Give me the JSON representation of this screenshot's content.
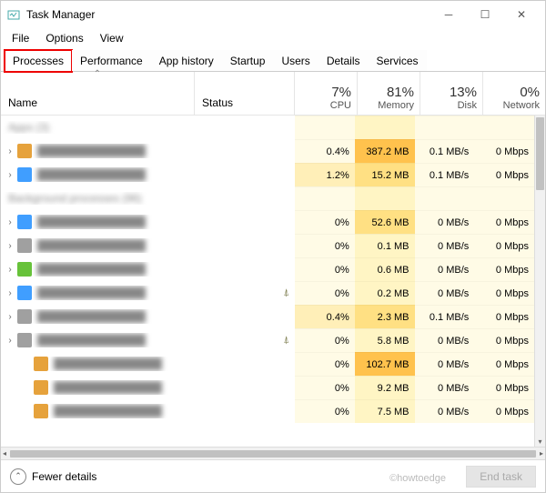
{
  "window": {
    "title": "Task Manager"
  },
  "menu": {
    "file": "File",
    "options": "Options",
    "view": "View"
  },
  "tabs": {
    "processes": "Processes",
    "performance": "Performance",
    "apphistory": "App history",
    "startup": "Startup",
    "users": "Users",
    "details": "Details",
    "services": "Services"
  },
  "columns": {
    "name": "Name",
    "status": "Status",
    "cpu": {
      "pct": "7%",
      "label": "CPU"
    },
    "memory": {
      "pct": "81%",
      "label": "Memory"
    },
    "disk": {
      "pct": "13%",
      "label": "Disk"
    },
    "network": {
      "pct": "0%",
      "label": "Network"
    }
  },
  "rows": [
    {
      "type": "group",
      "name": "Apps (3)"
    },
    {
      "type": "proc",
      "indent": 1,
      "iconColor": "#e6a23c",
      "cpu": "0.4%",
      "mem": "387.2 MB",
      "memHeat": "h",
      "disk": "0.1 MB/s",
      "net": "0 Mbps"
    },
    {
      "type": "proc",
      "indent": 1,
      "iconColor": "#409eff",
      "cpu": "1.2%",
      "cpuHeat": "m",
      "mem": "15.2 MB",
      "memHeat": "m",
      "disk": "0.1 MB/s",
      "net": "0 Mbps"
    },
    {
      "type": "group",
      "name": "Background processes (96)"
    },
    {
      "type": "proc",
      "indent": 1,
      "iconColor": "#409eff",
      "cpu": "0%",
      "mem": "52.6 MB",
      "memHeat": "m",
      "disk": "0 MB/s",
      "net": "0 Mbps"
    },
    {
      "type": "proc",
      "indent": 1,
      "iconColor": "#a0a0a0",
      "cpu": "0%",
      "mem": "0.1 MB",
      "disk": "0 MB/s",
      "net": "0 Mbps"
    },
    {
      "type": "proc",
      "indent": 1,
      "iconColor": "#67c23a",
      "cpu": "0%",
      "mem": "0.6 MB",
      "disk": "0 MB/s",
      "net": "0 Mbps"
    },
    {
      "type": "proc",
      "indent": 1,
      "iconColor": "#409eff",
      "status": "leaf",
      "cpu": "0%",
      "mem": "0.2 MB",
      "disk": "0 MB/s",
      "net": "0 Mbps"
    },
    {
      "type": "proc",
      "indent": 1,
      "iconColor": "#a0a0a0",
      "cpu": "0.4%",
      "cpuHeat": "m",
      "mem": "2.3 MB",
      "memHeat": "m",
      "disk": "0.1 MB/s",
      "net": "0 Mbps"
    },
    {
      "type": "proc",
      "indent": 1,
      "iconColor": "#a0a0a0",
      "status": "leaf",
      "cpu": "0%",
      "mem": "5.8 MB",
      "disk": "0 MB/s",
      "net": "0 Mbps"
    },
    {
      "type": "proc",
      "indent": 2,
      "iconColor": "#e6a23c",
      "cpu": "0%",
      "mem": "102.7 MB",
      "memHeat": "h",
      "disk": "0 MB/s",
      "net": "0 Mbps"
    },
    {
      "type": "proc",
      "indent": 2,
      "iconColor": "#e6a23c",
      "cpu": "0%",
      "mem": "9.2 MB",
      "disk": "0 MB/s",
      "net": "0 Mbps"
    },
    {
      "type": "proc",
      "indent": 2,
      "iconColor": "#e6a23c",
      "cpu": "0%",
      "mem": "7.5 MB",
      "disk": "0 MB/s",
      "net": "0 Mbps"
    }
  ],
  "footer": {
    "fewer": "Fewer details",
    "endtask": "End task",
    "watermark": "©howtoedge"
  }
}
